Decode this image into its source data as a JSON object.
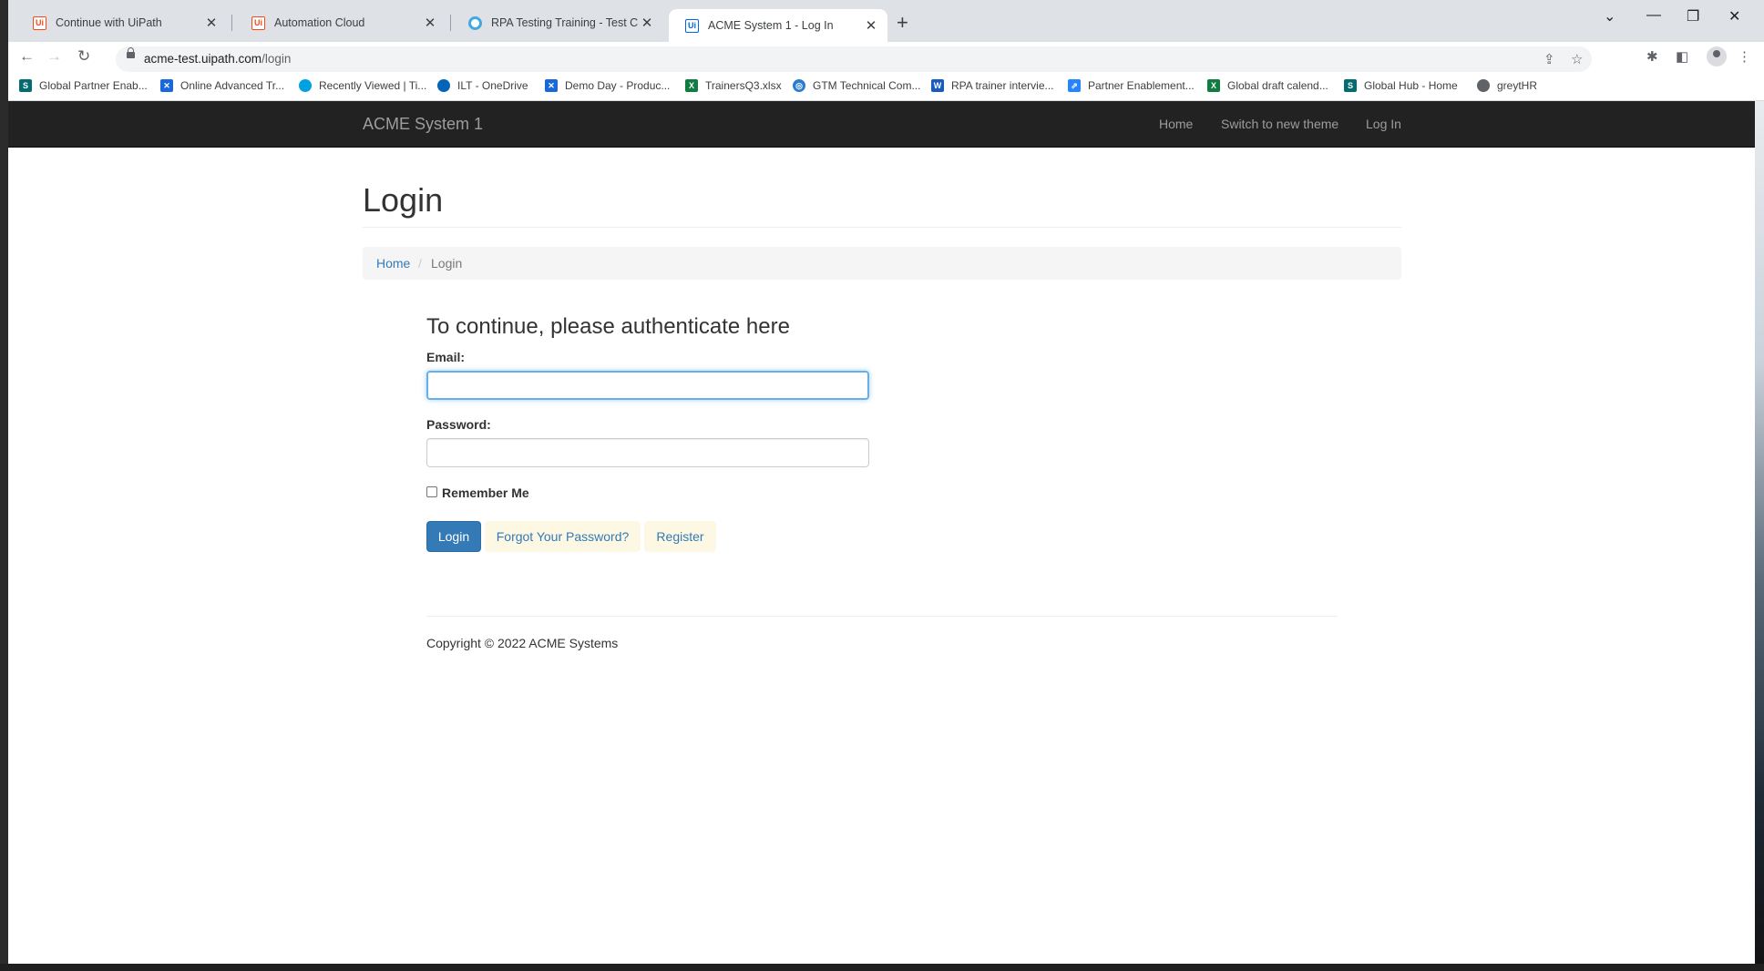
{
  "browser": {
    "tabs": [
      {
        "title": "Continue with UiPath",
        "icon": "uipath-icon",
        "active": false
      },
      {
        "title": "Automation Cloud",
        "icon": "uipath-icon",
        "active": false
      },
      {
        "title": "RPA Testing Training - Test Cases",
        "icon": "ring-icon",
        "active": false
      },
      {
        "title": "ACME System 1 - Log In",
        "icon": "uipath-icon",
        "active": true
      }
    ],
    "new_tab_glyph": "+",
    "close_glyph": "✕",
    "url_domain": "acme-test.uipath.com",
    "url_path": "/login",
    "bookmarks": [
      {
        "label": "Global Partner Enab...",
        "icon": "sharepoint-icon",
        "color": "#036c70"
      },
      {
        "label": "Online Advanced Tr...",
        "icon": "confluence-icon",
        "color": "#1868db"
      },
      {
        "label": "Recently Viewed | Ti...",
        "icon": "salesforce-icon",
        "color": "#00a1e0"
      },
      {
        "label": "ILT - OneDrive",
        "icon": "onedrive-icon",
        "color": "#0364b8"
      },
      {
        "label": "Demo Day - Produc...",
        "icon": "confluence-icon",
        "color": "#1868db"
      },
      {
        "label": "TrainersQ3.xlsx",
        "icon": "excel-icon",
        "color": "#107c41"
      },
      {
        "label": "GTM Technical Com...",
        "icon": "circle-icon",
        "color": "#2b7bd1"
      },
      {
        "label": "RPA trainer intervie...",
        "icon": "word-icon",
        "color": "#185abd"
      },
      {
        "label": "Partner Enablement...",
        "icon": "jira-icon",
        "color": "#2684ff"
      },
      {
        "label": "Global draft calend...",
        "icon": "excel-icon",
        "color": "#107c41"
      },
      {
        "label": "Global Hub - Home",
        "icon": "sharepoint-icon",
        "color": "#036c70"
      },
      {
        "label": "greytHR",
        "icon": "globe-icon",
        "color": "#5f6368"
      }
    ]
  },
  "acme": {
    "brand": "ACME System 1",
    "nav": {
      "home": "Home",
      "theme": "Switch to new theme",
      "login": "Log In"
    },
    "page_title": "Login",
    "breadcrumb": {
      "home": "Home",
      "sep": "/",
      "current": "Login"
    },
    "form": {
      "title": "To continue, please authenticate here",
      "email_label": "Email:",
      "email_value": "",
      "password_label": "Password:",
      "password_value": "",
      "remember_label": "Remember Me",
      "remember_checked": false,
      "login_button": "Login",
      "forgot_link": "Forgot Your Password?",
      "register_link": "Register"
    },
    "footer": "Copyright © 2022 ACME Systems",
    "colors": {
      "navbar": "#222222",
      "primary": "#337ab7",
      "link_bg": "#fcf8e3",
      "focus": "#66afe9"
    }
  }
}
